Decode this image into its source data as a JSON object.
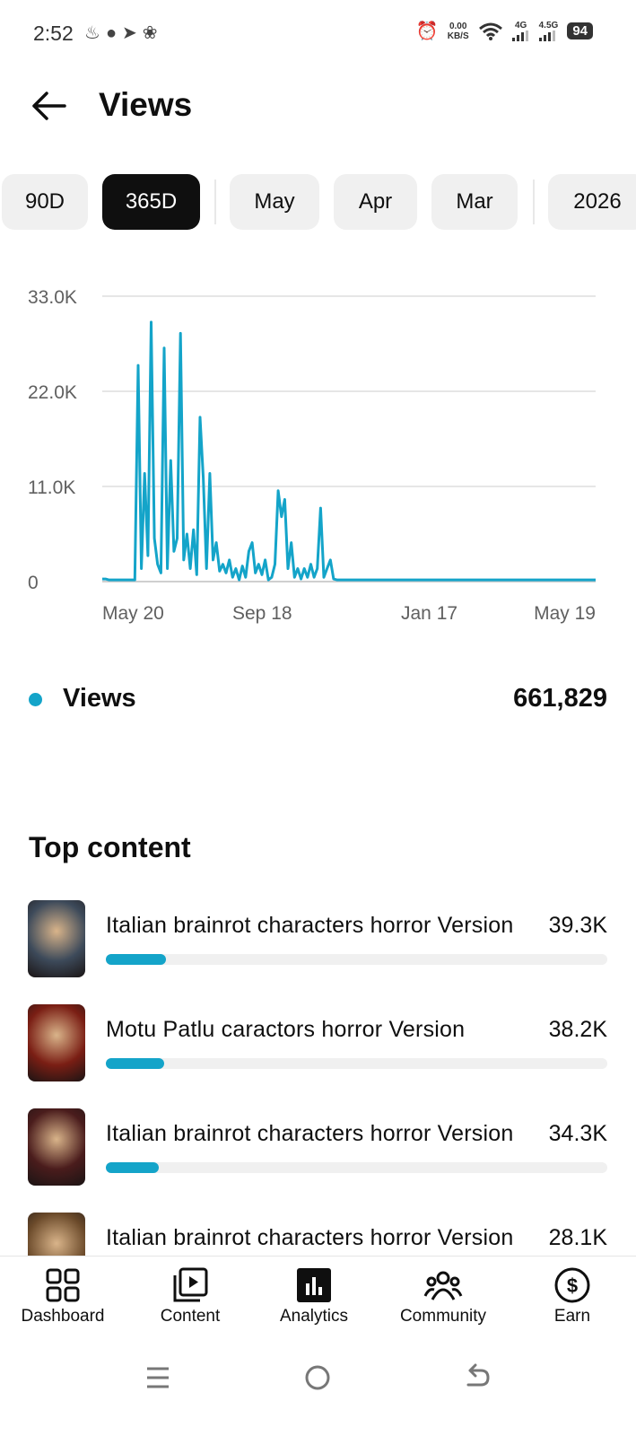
{
  "status_bar": {
    "time": "2:52",
    "netspeed_value": "0.00",
    "netspeed_unit": "KB/S",
    "signal_1": "4G",
    "signal_2": "4.5G",
    "battery": "94"
  },
  "header": {
    "title": "Views"
  },
  "chips": [
    {
      "label": "90D",
      "active": false
    },
    {
      "label": "365D",
      "active": true
    },
    {
      "label": "May",
      "active": false
    },
    {
      "label": "Apr",
      "active": false
    },
    {
      "label": "Mar",
      "active": false
    },
    {
      "label": "2026",
      "active": false
    }
  ],
  "chart_data": {
    "type": "line",
    "title": "",
    "xlabel": "",
    "ylabel": "",
    "y_tick_labels": [
      "0",
      "11.0K",
      "22.0K",
      "33.0K"
    ],
    "y_ticks": [
      0,
      11000,
      22000,
      33000
    ],
    "ylim": [
      0,
      33000
    ],
    "x_tick_labels": [
      "May 20",
      "Sep 18",
      "Jan 17",
      "May 19"
    ],
    "grid": true,
    "color": "#14a4c9",
    "series": [
      {
        "name": "Views",
        "x": [
          "May 20",
          "May 23",
          "May 26",
          "May 29",
          "Jun 1",
          "Jun 4",
          "Jun 7",
          "Jun 10",
          "Jun 13",
          "Jun 16",
          "Jun 17",
          "Jun 19",
          "Jun 20",
          "Jun 21",
          "Jun 23",
          "Jun 25",
          "Jun 27",
          "Jun 29",
          "Jul 1",
          "Jul 3",
          "Jul 5",
          "Jul 6",
          "Jul 8",
          "Jul 10",
          "Jul 12",
          "Jul 14",
          "Jul 16",
          "Jul 17",
          "Jul 19",
          "Jul 21",
          "Jul 23",
          "Jul 25",
          "Jul 27",
          "Jul 29",
          "Jul 31",
          "Aug 2",
          "Aug 4",
          "Aug 6",
          "Aug 8",
          "Aug 10",
          "Aug 12",
          "Aug 14",
          "Aug 17",
          "Aug 20",
          "Aug 23",
          "Aug 26",
          "Aug 29",
          "Sep 1",
          "Sep 4",
          "Sep 7",
          "Sep 10",
          "Sep 13",
          "Sep 16",
          "Sep 19",
          "Sep 22",
          "Sep 25",
          "Sep 28",
          "Oct 1",
          "Oct 4",
          "Oct 7",
          "Oct 10",
          "Oct 13",
          "Oct 16",
          "Oct 19",
          "Oct 22",
          "Oct 23",
          "Oct 25",
          "Oct 27",
          "Oct 29",
          "Oct 31",
          "Nov 2",
          "Nov 5",
          "Nov 8",
          "Nov 11",
          "Nov 14",
          "Nov 17",
          "Nov 20",
          "Nov 22",
          "Nov 24",
          "Nov 26",
          "Nov 28",
          "Nov 30",
          "Dec 3",
          "Dec 6",
          "Dec 9",
          "Dec 12",
          "Dec 15",
          "Dec 18",
          "Jan 17",
          "Feb 16",
          "Mar 18",
          "Apr 1",
          "Apr 3",
          "Apr 5",
          "Apr 17",
          "May 19"
        ],
        "values": [
          300,
          300,
          200,
          200,
          200,
          200,
          200,
          200,
          200,
          200,
          200,
          25000,
          1500,
          12500,
          3000,
          30000,
          5000,
          2000,
          1000,
          27000,
          1500,
          14000,
          3500,
          5000,
          28700,
          2500,
          5500,
          1500,
          6000,
          800,
          19000,
          12000,
          1500,
          12500,
          2500,
          4500,
          1200,
          2000,
          1000,
          2500,
          500,
          1500,
          200,
          1800,
          500,
          3500,
          4500,
          1000,
          2000,
          800,
          2500,
          200,
          500,
          2000,
          10500,
          7500,
          9500,
          1500,
          4500,
          500,
          1500,
          300,
          1500,
          500,
          2000,
          500,
          1500,
          8500,
          500,
          1500,
          2500,
          300,
          200,
          200,
          200,
          200,
          200,
          200,
          200,
          200,
          200,
          200,
          200,
          200,
          200,
          200,
          200,
          200,
          200,
          200,
          200,
          200,
          200,
          200,
          200,
          200
        ]
      }
    ]
  },
  "legend": {
    "label": "Views",
    "value": "661,829",
    "color": "#14a4c9"
  },
  "top_content": {
    "title": "Top content",
    "max_value": 39300,
    "items": [
      {
        "title": "Italian brainrot characters horror Version",
        "display": "39.3K",
        "fill": 0.12,
        "thumb": "horror-character-thumbnail",
        "bg": "#3d4a5a"
      },
      {
        "title": "Motu Patlu caractors horror Version",
        "display": "38.2K",
        "fill": 0.117,
        "thumb": "horror-character-thumbnail",
        "bg": "#7a1e14"
      },
      {
        "title": "Italian brainrot characters horror Version",
        "display": "34.3K",
        "fill": 0.105,
        "thumb": "horror-character-thumbnail",
        "bg": "#4a1c1c"
      },
      {
        "title": "Italian brainrot characters horror Version",
        "display": "28.1K",
        "fill": 0.086,
        "thumb": "horror-character-thumbnail",
        "bg": "#6b4a2a"
      }
    ]
  },
  "bottom_nav": [
    {
      "label": "Dashboard",
      "icon": "dashboard-icon"
    },
    {
      "label": "Content",
      "icon": "content-icon"
    },
    {
      "label": "Analytics",
      "icon": "analytics-icon"
    },
    {
      "label": "Community",
      "icon": "community-icon"
    },
    {
      "label": "Earn",
      "icon": "earn-icon"
    }
  ]
}
